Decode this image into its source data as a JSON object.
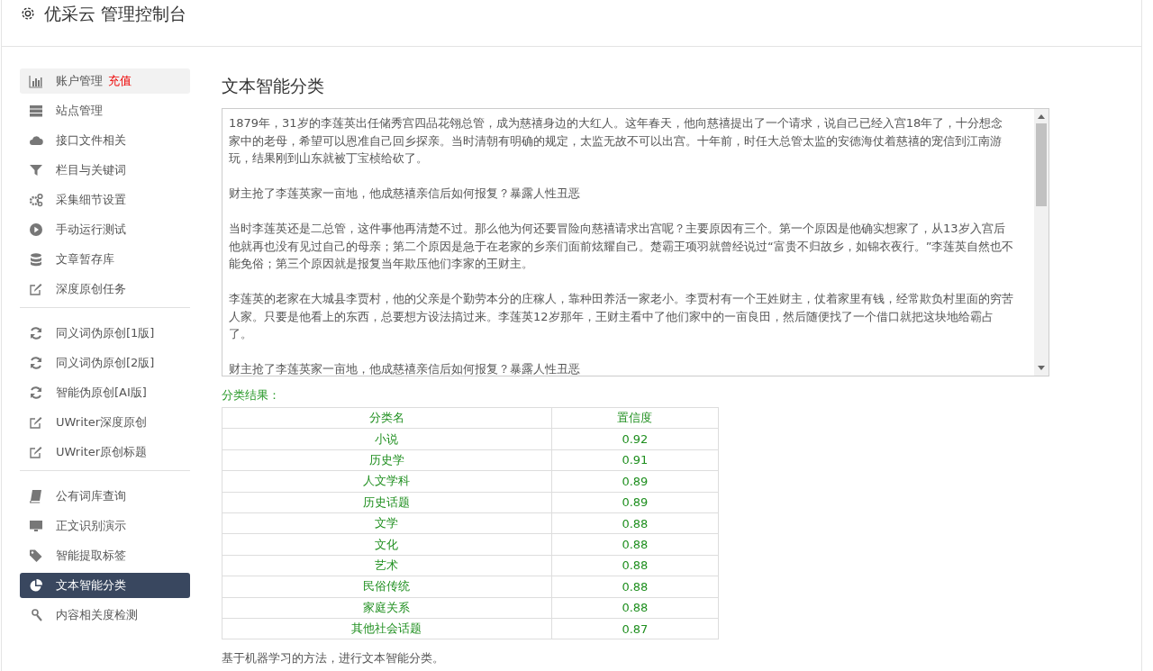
{
  "header": {
    "title": "优采云 管理控制台"
  },
  "sidebar": {
    "groups": [
      [
        {
          "label": "账户管理",
          "badge": "充值",
          "highlighted": true,
          "selected": false
        },
        {
          "label": "站点管理",
          "highlighted": false,
          "selected": false
        },
        {
          "label": "接口文件相关",
          "highlighted": false,
          "selected": false
        },
        {
          "label": "栏目与关键词",
          "highlighted": false,
          "selected": false
        },
        {
          "label": "采集细节设置",
          "highlighted": false,
          "selected": false
        },
        {
          "label": "手动运行测试",
          "highlighted": false,
          "selected": false
        },
        {
          "label": "文章暂存库",
          "highlighted": false,
          "selected": false
        },
        {
          "label": "深度原创任务",
          "highlighted": false,
          "selected": false
        }
      ],
      [
        {
          "label": "同义词伪原创[1版]",
          "highlighted": false,
          "selected": false
        },
        {
          "label": "同义词伪原创[2版]",
          "highlighted": false,
          "selected": false
        },
        {
          "label": "智能伪原创[AI版]",
          "highlighted": false,
          "selected": false
        },
        {
          "label": "UWriter深度原创",
          "highlighted": false,
          "selected": false
        },
        {
          "label": "UWriter原创标题",
          "highlighted": false,
          "selected": false
        }
      ],
      [
        {
          "label": "公有词库查询",
          "highlighted": false,
          "selected": false
        },
        {
          "label": "正文识别演示",
          "highlighted": false,
          "selected": false
        },
        {
          "label": "智能提取标签",
          "highlighted": false,
          "selected": false
        },
        {
          "label": "文本智能分类",
          "highlighted": false,
          "selected": true
        },
        {
          "label": "内容相关度检测",
          "highlighted": false,
          "selected": false
        }
      ]
    ]
  },
  "main": {
    "title": "文本智能分类",
    "article_paragraphs": [
      "1879年，31岁的李莲英出任储秀宫四品花翎总管，成为慈禧身边的大红人。这年春天，他向慈禧提出了一个请求，说自己已经入宫18年了，十分想念家中的老母，希望可以恩准自己回乡探亲。当时清朝有明确的规定，太监无故不可以出宫。十年前，时任大总管太监的安德海仗着慈禧的宠信到江南游玩，结果刚到山东就被丁宝桢给砍了。",
      "财主抢了李莲英家一亩地，他成慈禧亲信后如何报复？暴露人性丑恶",
      "当时李莲英还是二总管，这件事他再清楚不过。那么他为何还要冒险向慈禧请求出宫呢？主要原因有三个。第一个原因是他确实想家了，从13岁入宫后他就再也没有见过自己的母亲；第二个原因是急于在老家的乡亲们面前炫耀自己。楚霸王项羽就曾经说过“富贵不归故乡，如锦衣夜行。”李莲英自然也不能免俗；第三个原因就是报复当年欺压他们李家的王财主。",
      "李莲英的老家在大城县李贾村，他的父亲是个勤劳本分的庄稼人，靠种田养活一家老小。李贾村有一个王姓财主，仗着家里有钱，经常欺负村里面的穷苦人家。只要是他看上的东西，总要想方设法搞过来。李莲英12岁那年，王财主看中了他们家中的一亩良田，然后随便找了一个借口就把这块地给霸占了。",
      "财主抢了李莲英家一亩地，他成慈禧亲信后如何报复？暴露人性丑恶"
    ],
    "result_label": "分类结果：",
    "table": {
      "columns": [
        "分类名",
        "置信度"
      ],
      "rows": [
        [
          "小说",
          "0.92"
        ],
        [
          "历史学",
          "0.91"
        ],
        [
          "人文学科",
          "0.89"
        ],
        [
          "历史话题",
          "0.89"
        ],
        [
          "文学",
          "0.88"
        ],
        [
          "文化",
          "0.88"
        ],
        [
          "艺术",
          "0.88"
        ],
        [
          "民俗传统",
          "0.88"
        ],
        [
          "家庭关系",
          "0.88"
        ],
        [
          "其他社会话题",
          "0.87"
        ]
      ]
    },
    "footnote": "基于机器学习的方法，进行文本智能分类。"
  }
}
